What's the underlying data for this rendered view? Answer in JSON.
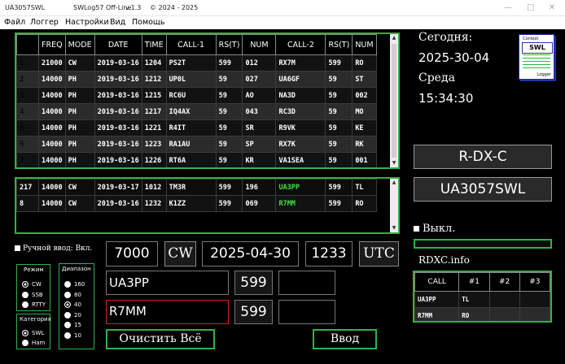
{
  "window": {
    "callsign_title": "UA3057SWL",
    "app_title": "SWLog57  Off-Line",
    "version": "v.1.3",
    "copyright": "© 2024 - 2025"
  },
  "menu": [
    "Файл",
    "Логгер",
    "Настройки",
    "Вид",
    "Помощь"
  ],
  "log_table": {
    "headers": [
      "FREQ",
      "MODE",
      "DATE",
      "TIME",
      "CALL-1",
      "RS(T)",
      "NUM",
      "CALL-2",
      "RS(T)",
      "NUM"
    ],
    "rows": [
      [
        "1",
        "21000",
        "CW",
        "2019-03-16",
        "1204",
        "PS2T",
        "599",
        "012",
        "RX7M",
        "599",
        "RO"
      ],
      [
        "2",
        "14000",
        "PH",
        "2019-03-16",
        "1212",
        "UP0L",
        "59",
        "027",
        "UA6GF",
        "59",
        "ST"
      ],
      [
        "3",
        "14000",
        "PH",
        "2019-03-16",
        "1215",
        "RC6U",
        "59",
        "AO",
        "NA3D",
        "59",
        "002"
      ],
      [
        "4",
        "14000",
        "PH",
        "2019-03-16",
        "1217",
        "IQ4AX",
        "59",
        "043",
        "RC3D",
        "59",
        "MO"
      ],
      [
        "5",
        "14000",
        "PH",
        "2019-03-16",
        "1221",
        "R4IT",
        "59",
        "SR",
        "R9VK",
        "59",
        "KE"
      ],
      [
        "6",
        "14000",
        "PH",
        "2019-03-16",
        "1223",
        "RA1AU",
        "59",
        "SP",
        "RX7K",
        "59",
        "RK"
      ],
      [
        "7",
        "14000",
        "PH",
        "2019-03-16",
        "1226",
        "RT6A",
        "59",
        "KR",
        "VA1SEA",
        "59",
        "001"
      ],
      [
        "8",
        "14000",
        "CW",
        "2019-03-16",
        "1232",
        "K1ZZ",
        "599",
        "069",
        "R7MM",
        "599",
        "RO"
      ]
    ]
  },
  "search_table": {
    "rows": [
      [
        "217",
        "14000",
        "CW",
        "2019-03-17",
        "1012",
        "TM3R",
        "599",
        "196",
        "UA3PP",
        "599",
        "TL"
      ],
      [
        "8",
        "14000",
        "CW",
        "2019-03-16",
        "1232",
        "K1ZZ",
        "599",
        "069",
        "R7MM",
        "599",
        "RO"
      ]
    ]
  },
  "manual_input": "Ручной ввод: Вкл.",
  "mode_group": {
    "title": "Режим",
    "options": [
      "CW",
      "SSB",
      "RTTY"
    ]
  },
  "category_group": {
    "title": "Категория",
    "options": [
      "SWL",
      "Ham"
    ]
  },
  "band_group": {
    "title": "Диапазон",
    "options": [
      "160",
      "80",
      "40",
      "20",
      "15",
      "10"
    ]
  },
  "entry": {
    "freq": "7000",
    "mode": "CW",
    "date": "2025-04-30",
    "time": "1233",
    "tz": "UTC",
    "call1": "UA3PP",
    "rst1": "599",
    "num1": "",
    "call2": "R7MM",
    "rst2": "599",
    "num2": ""
  },
  "buttons": {
    "clear": "Очистить Всё",
    "enter": "Ввод"
  },
  "info": {
    "today_label": "Сегодня:",
    "date": "2025-30-04",
    "weekday": "Среда",
    "time": "15:34:30"
  },
  "logo": {
    "top": "Contest",
    "mid": "SWL",
    "bottom": "Logger"
  },
  "contest_name": "R-DX-C",
  "operator": "UA3057SWL",
  "status_label": "Выкл.",
  "rdxc_label": "RDXC.info",
  "rdxc_table": {
    "headers": [
      "CALL",
      "#1",
      "#2",
      "#3"
    ],
    "rows": [
      [
        "UA3PP",
        "TL",
        "",
        ""
      ],
      [
        "R7MM",
        "RO",
        "",
        ""
      ]
    ]
  },
  "colors": {
    "accent": "#2fb24a",
    "highlight_call": "#3ee33e",
    "error_border": "#d02020"
  }
}
